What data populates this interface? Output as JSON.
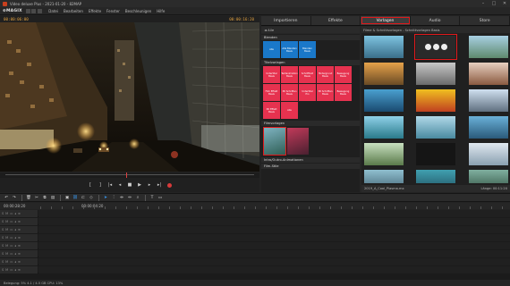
{
  "window": {
    "title": "Video deluxe Plus - 2021-01-20 - 82MAP"
  },
  "menu": {
    "logo": "⊕MAGIX",
    "items": [
      "Datei",
      "Bearbeiten",
      "Effekte",
      "Fenster",
      "Beschleunigen",
      "Hilfe"
    ]
  },
  "monitor": {
    "timecode_left": "00:00:06:00",
    "timecode_right": "00:00:16:20",
    "position_label": "00:00"
  },
  "pool": {
    "tabs": [
      "Importieren",
      "Effekte",
      "Vorlagen",
      "Audio",
      "Store"
    ],
    "active_tab": "Vorlagen",
    "breadcrumb": "◄  Alle",
    "sections": {
      "blenden": "Blenden",
      "titelvorlagen": "Titelvorlagen",
      "filmvorlagen": "Filmvorlagen",
      "intro": "Intro/Outro-Animationen",
      "more": "Film-Stile"
    },
    "blenden_tiles": [
      "Alle",
      "Alle Blenden Basis",
      "Blenden Basis"
    ],
    "titel_tiles": [
      "Untertitel Basis",
      "Textanimation Basis",
      "Schriftfeld Basis",
      "Hintergrund Basis",
      "Bewegung Basis",
      "Film Effekt Basis",
      "3D Schriften Basis",
      "Untertitel Pro",
      "3D Schriften Basis",
      "Bewegung Basis",
      "3D Effekt Basis",
      "Alle"
    ],
    "content_header": "Filme & Schnittvorlagen - Schnittvorlagen Basis",
    "content_footer_left": "2019_A_Cool_Plasma.mx",
    "content_footer_right": "Länge: 00:11:20"
  },
  "timeline": {
    "ruler_left": "00:00:28:20",
    "marker": "00:00:04:20"
  },
  "status": {
    "text": "Belegung: 5% 4.1 / 4.5 GB   CPU: 13%"
  },
  "colors": {
    "accent_red": "#e0191b",
    "tile_red": "#e6324f",
    "tile_blue": "#1a78c9",
    "timecode": "#e0a040"
  },
  "icons": [
    "minimize-icon",
    "maximize-icon",
    "close-icon",
    "play-icon",
    "stop-icon",
    "record-icon",
    "cut-icon",
    "undo-icon",
    "redo-icon"
  ]
}
